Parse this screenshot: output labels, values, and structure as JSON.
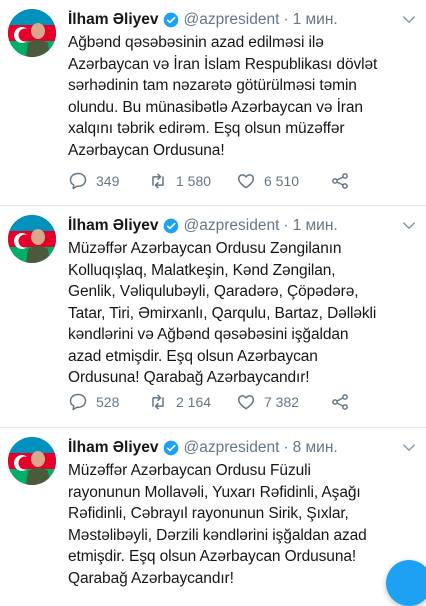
{
  "tweets": [
    {
      "name": "İlham Əliyev",
      "handle": "@azpresident",
      "time": "1 мин.",
      "lines": [
        "Ağbənd qəsəbəsinin azad edilməsi ilə",
        "Azərbaycan və İran İslam Respublikası dövlət",
        "sərhədinin tam nəzarətə götürülməsi təmin",
        "olundu. Bu münasibətlə Azərbaycan və İran",
        "xalqını təbrik edirəm. Eşq olsun müzəffər",
        "Azərbaycan Ordusuna!"
      ],
      "replies": "349",
      "retweets": "1 580",
      "likes": "6 510"
    },
    {
      "name": "İlham Əliyev",
      "handle": "@azpresident",
      "time": "1 мин.",
      "lines": [
        "Müzəffər Azərbaycan Ordusu Zəngilanın",
        "Kolluqışlaq, Malatkeşin, Kənd Zəngilan,",
        "Genlik, Vəliqulubəyli, Qaradərə, Çöpədərə,",
        "Tatar, Tiri, Əmirxanlı, Qarqulu, Bartaz, Dəlləkli",
        "kəndlərini və Ağbənd qəsəbəsini işğaldan",
        "azad etmişdir. Eşq olsun Azərbaycan",
        "Ordusuna! Qarabağ Azərbaycandır!"
      ],
      "replies": "528",
      "retweets": "2 164",
      "likes": "7 382"
    },
    {
      "name": "İlham Əliyev",
      "handle": "@azpresident",
      "time": "8 мин.",
      "lines": [
        "Müzəffər Azərbaycan Ordusu Füzuli",
        "rayonunun Mollavəli, Yuxarı Rəfidinli, Aşağı",
        "Rəfidinli, Cəbrayıl rayonunun Sirik, Şıxlar,",
        "Məstəlibəyli, Dərzili kəndlərini işğaldan azad",
        "etmişdir. Eşq olsun Azərbaycan Ordusuna!",
        "Qarabağ Azərbaycandır!"
      ]
    }
  ],
  "colors": {
    "text": "#14171a",
    "muted": "#657786",
    "verified": "#1da1f2",
    "divider": "#e1e8ed"
  }
}
